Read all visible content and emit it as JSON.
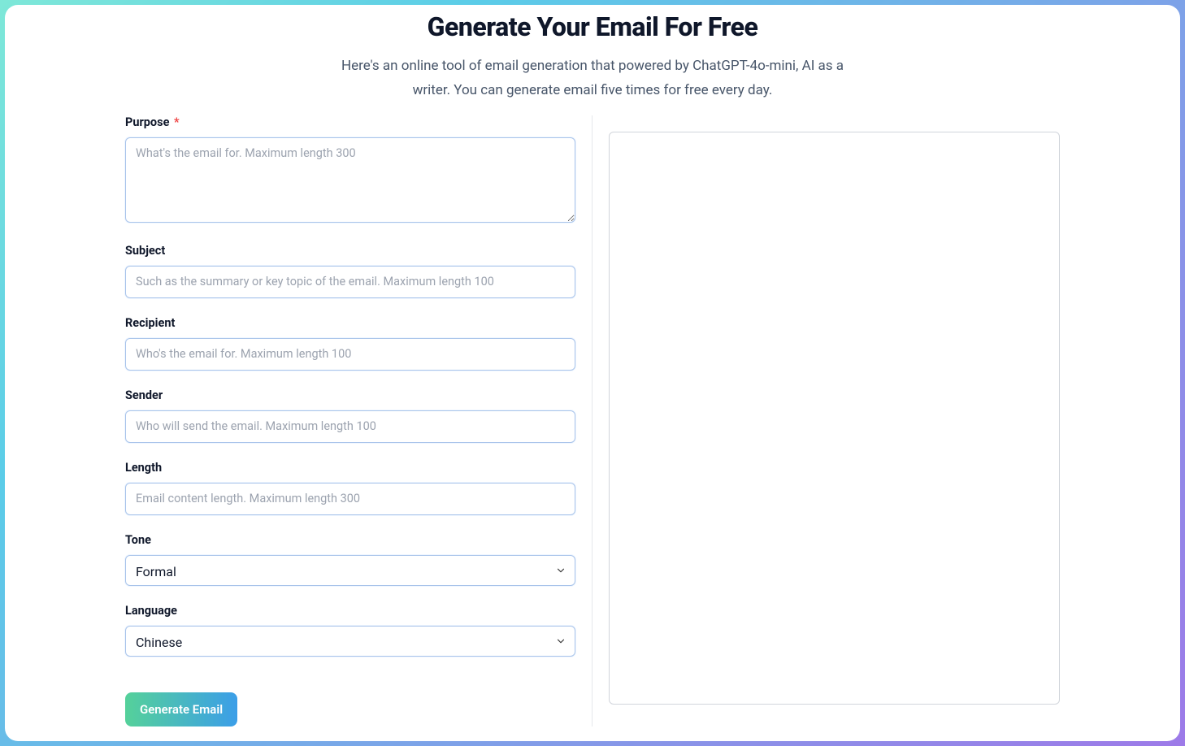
{
  "header": {
    "title": "Generate Your Email For Free",
    "subtitle": "Here's an online tool of email generation that powered by ChatGPT-4o-mini, AI as a writer. You can generate email five times for free every day."
  },
  "form": {
    "purpose": {
      "label": "Purpose",
      "required_mark": "*",
      "placeholder": "What's the email for. Maximum length 300",
      "value": ""
    },
    "subject": {
      "label": "Subject",
      "placeholder": "Such as the summary or key topic of the email. Maximum length 100",
      "value": ""
    },
    "recipient": {
      "label": "Recipient",
      "placeholder": "Who's the email for. Maximum length 100",
      "value": ""
    },
    "sender": {
      "label": "Sender",
      "placeholder": "Who will send the email. Maximum length 100",
      "value": ""
    },
    "length": {
      "label": "Length",
      "placeholder": "Email content length. Maximum length 300",
      "value": ""
    },
    "tone": {
      "label": "Tone",
      "selected": "Formal"
    },
    "language": {
      "label": "Language",
      "selected": "Chinese"
    },
    "submit_label": "Generate Email"
  },
  "output": {
    "value": ""
  }
}
